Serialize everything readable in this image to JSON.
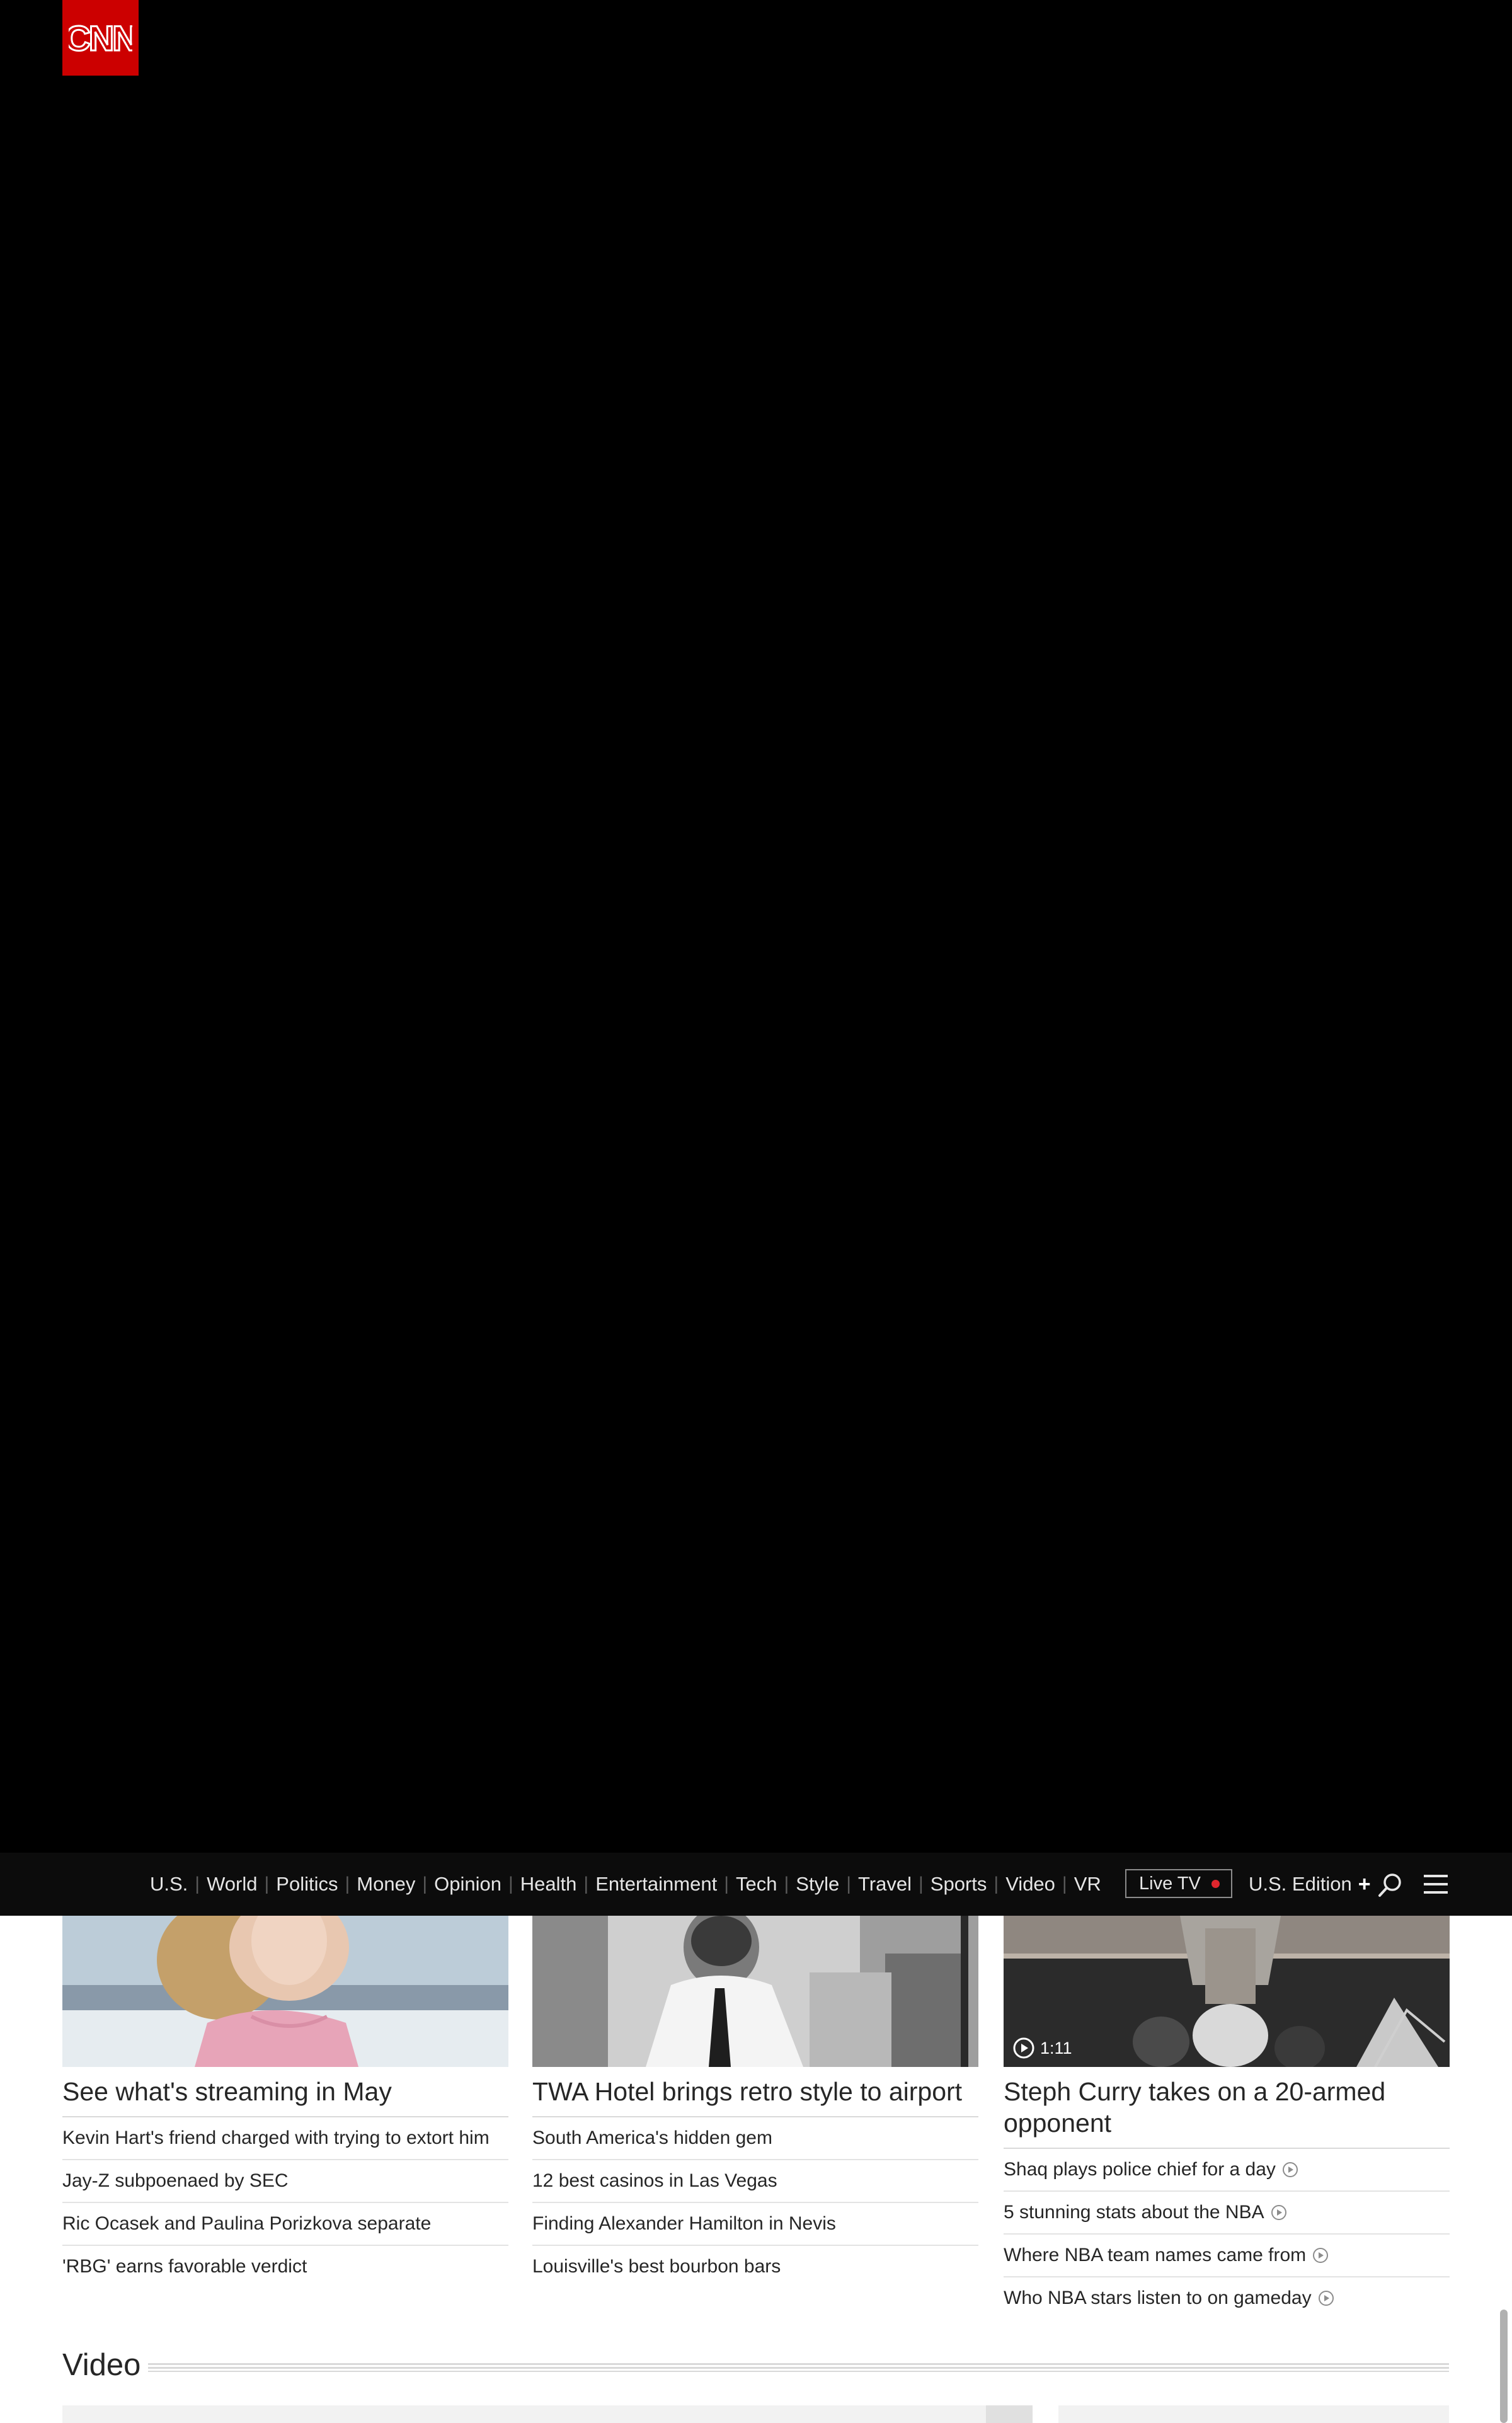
{
  "brand": {
    "logo_text": "CNN",
    "accent_color": "#cc0000"
  },
  "nav": {
    "items": [
      {
        "label": "U.S."
      },
      {
        "label": "World"
      },
      {
        "label": "Politics"
      },
      {
        "label": "Money"
      },
      {
        "label": "Opinion"
      },
      {
        "label": "Health"
      },
      {
        "label": "Entertainment"
      },
      {
        "label": "Tech"
      },
      {
        "label": "Style"
      },
      {
        "label": "Travel"
      },
      {
        "label": "Sports"
      },
      {
        "label": "Video"
      },
      {
        "label": "VR"
      }
    ],
    "live_tv_label": "Live TV",
    "edition_label": "U.S. Edition",
    "edition_plus": "+",
    "search_icon": "search-icon",
    "menu_icon": "hamburger-menu-icon"
  },
  "cards": [
    {
      "headline": "See what's streaming in May",
      "links": [
        {
          "text": "Kevin Hart's friend charged with trying to extort him"
        },
        {
          "text": "Jay-Z subpoenaed by SEC"
        },
        {
          "text": "Ric Ocasek and Paulina Porizkova separate"
        },
        {
          "text": "'RBG' earns favorable verdict"
        }
      ]
    },
    {
      "headline": "TWA Hotel brings retro style to airport",
      "links": [
        {
          "text": "South America's hidden gem"
        },
        {
          "text": "12 best casinos in Las Vegas"
        },
        {
          "text": "Finding Alexander Hamilton in Nevis"
        },
        {
          "text": "Louisville's best bourbon bars"
        }
      ]
    },
    {
      "headline": "Steph Curry takes on a 20-armed opponent",
      "video_duration": "1:11",
      "links": [
        {
          "text": "Shaq plays police chief for a day"
        },
        {
          "text": "5 stunning stats about the NBA"
        },
        {
          "text": "Where NBA team names came from"
        },
        {
          "text": "Who NBA stars listen to on gameday"
        }
      ]
    }
  ],
  "video_section": {
    "title": "Video"
  }
}
